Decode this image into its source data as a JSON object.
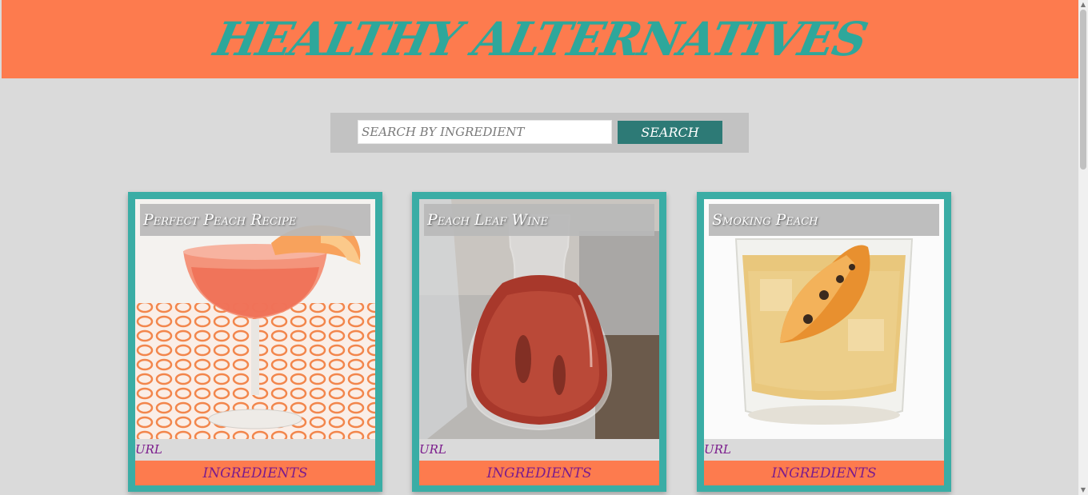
{
  "header": {
    "title": "HEALTHY ALTERNATIVES"
  },
  "search": {
    "placeholder": "SEARCH BY INGREDIENT",
    "value": "",
    "button_label": "SEARCH"
  },
  "cards": [
    {
      "title": "Perfect Peach Recipe",
      "url_label": "URL",
      "ingredients_label": "INGREDIENTS"
    },
    {
      "title": "Peach Leaf Wine",
      "url_label": "URL",
      "ingredients_label": "INGREDIENTS"
    },
    {
      "title": "Smoking Peach",
      "url_label": "URL",
      "ingredients_label": "INGREDIENTS"
    }
  ],
  "colors": {
    "header_bg": "#fd7b4e",
    "title": "#2ea79b",
    "card_border": "#3aada5",
    "search_button": "#2d7a76",
    "link": "#7b1c8d"
  }
}
